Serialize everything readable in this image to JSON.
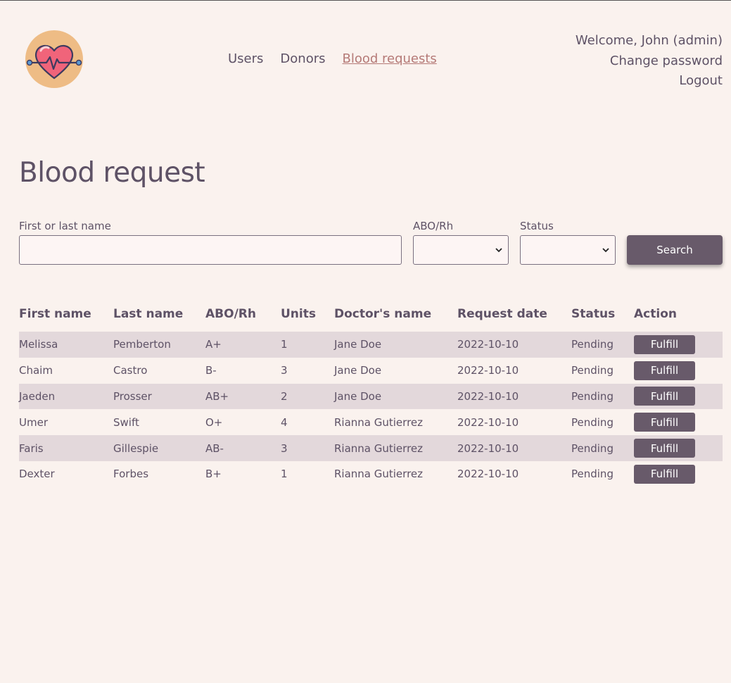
{
  "nav": {
    "items": [
      {
        "label": "Users",
        "active": false
      },
      {
        "label": "Donors",
        "active": false
      },
      {
        "label": "Blood requests",
        "active": true
      }
    ]
  },
  "user": {
    "welcome": "Welcome, John (admin)",
    "change_password": "Change password",
    "logout": "Logout"
  },
  "page": {
    "title": "Blood request"
  },
  "filters": {
    "name_label": "First or last name",
    "name_value": "",
    "abo_label": "ABO/Rh",
    "abo_value": "",
    "status_label": "Status",
    "status_value": "",
    "search_label": "Search"
  },
  "table": {
    "headers": [
      "First name",
      "Last name",
      "ABO/Rh",
      "Units",
      "Doctor's name",
      "Request date",
      "Status",
      "Action"
    ],
    "rows": [
      [
        "Melissa",
        "Pemberton",
        "A+",
        "1",
        "Jane Doe",
        "2022-10-10",
        "Pending",
        "Fulfill"
      ],
      [
        "Chaim",
        "Castro",
        "B-",
        "3",
        "Jane Doe",
        "2022-10-10",
        "Pending",
        "Fulfill"
      ],
      [
        "Jaeden",
        "Prosser",
        "AB+",
        "2",
        "Jane Doe",
        "2022-10-10",
        "Pending",
        "Fulfill"
      ],
      [
        "Umer",
        "Swift",
        "O+",
        "4",
        "Rianna Gutierrez",
        "2022-10-10",
        "Pending",
        "Fulfill"
      ],
      [
        "Faris",
        "Gillespie",
        "AB-",
        "3",
        "Rianna Gutierrez",
        "2022-10-10",
        "Pending",
        "Fulfill"
      ],
      [
        "Dexter",
        "Forbes",
        "B+",
        "1",
        "Rianna Gutierrez",
        "2022-10-10",
        "Pending",
        "Fulfill"
      ]
    ]
  },
  "colors": {
    "background": "#faf2ee",
    "text": "#5e5266",
    "accent": "#685a6a",
    "active_link": "#b57a77",
    "row_stripe": "#e3d8db"
  },
  "icons": {
    "logo": "heart-pulse-icon",
    "select": "chevron-down-icon"
  }
}
